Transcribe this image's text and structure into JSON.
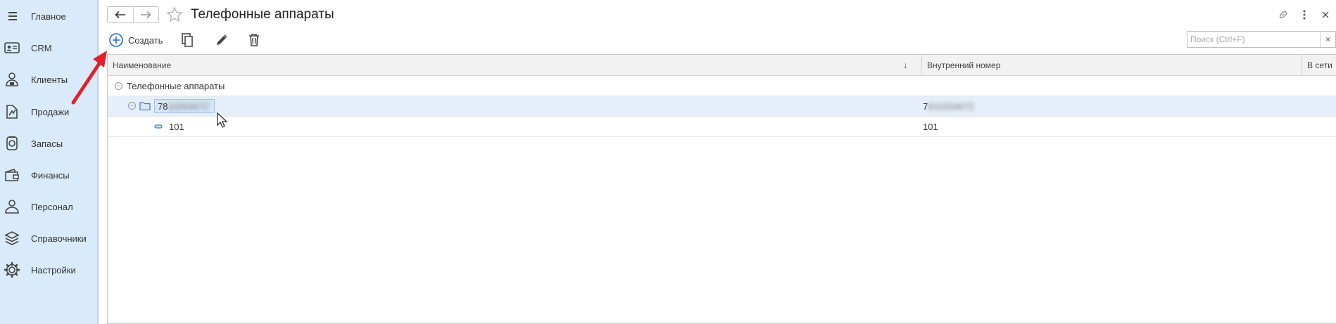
{
  "sidebar": {
    "items": [
      {
        "label": "Главное",
        "icon": "menu-icon"
      },
      {
        "label": "CRM",
        "icon": "id-card-icon"
      },
      {
        "label": "Клиенты",
        "icon": "client-icon"
      },
      {
        "label": "Продажи",
        "icon": "sales-icon"
      },
      {
        "label": "Запасы",
        "icon": "stock-icon"
      },
      {
        "label": "Финансы",
        "icon": "wallet-icon"
      },
      {
        "label": "Персонал",
        "icon": "staff-icon"
      },
      {
        "label": "Справочники",
        "icon": "layers-icon"
      },
      {
        "label": "Настройки",
        "icon": "gear-icon"
      }
    ]
  },
  "header": {
    "title": "Телефонные аппараты"
  },
  "toolbar": {
    "create_label": "Создать"
  },
  "search": {
    "placeholder": "Поиск (Ctrl+F)",
    "value": "",
    "clear_label": "×"
  },
  "table": {
    "columns": [
      "Наименование",
      "Внутренний номер",
      "В сети"
    ],
    "sort_indicator": "↓",
    "rows": [
      {
        "name": "Телефонные аппараты",
        "number": "",
        "online": ""
      },
      {
        "name_visible": "78",
        "name_blurred": "10264672",
        "number_visible": "7",
        "number_blurred": "810264672",
        "online": ""
      },
      {
        "name": "101",
        "number": "101",
        "online": ""
      }
    ]
  },
  "colors": {
    "sidebar_bg": "#d9ebfa",
    "selected_row": "#e5eef9",
    "accent": "#1d6fc2",
    "annotation_arrow": "#e0202a"
  }
}
